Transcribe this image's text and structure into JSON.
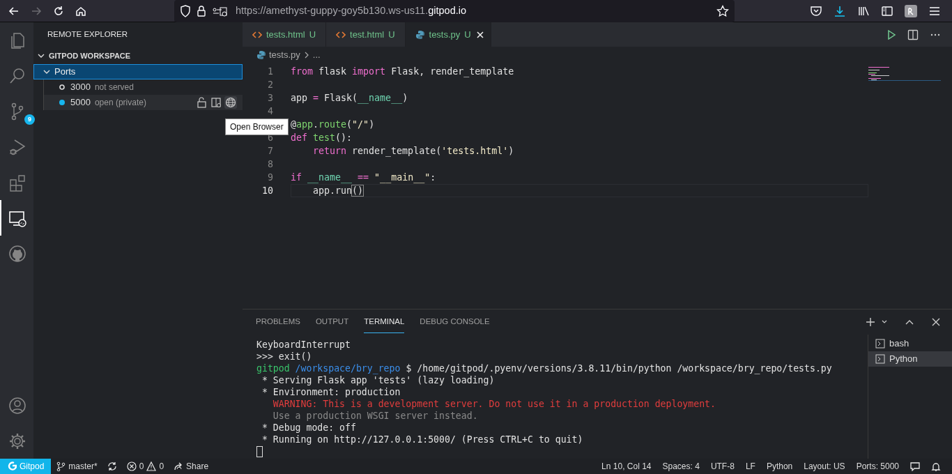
{
  "browser": {
    "nav": [
      {
        "kind": "back",
        "disabled": false
      },
      {
        "kind": "forward",
        "disabled": true
      },
      {
        "kind": "reload",
        "disabled": false
      },
      {
        "kind": "home",
        "disabled": false
      }
    ],
    "url_prefix": "https://amethyst-guppy-goy5b130.ws-us11.",
    "url_domain": "gitpod.io"
  },
  "activity_bar": {
    "items": [
      {
        "kind": "explorer",
        "selected": false
      },
      {
        "kind": "search",
        "selected": false
      },
      {
        "kind": "source-control",
        "selected": false,
        "badge": "9"
      },
      {
        "kind": "run-debug",
        "selected": false
      },
      {
        "kind": "extensions",
        "selected": false
      },
      {
        "kind": "remote",
        "selected": true
      },
      {
        "kind": "github",
        "selected": false
      }
    ],
    "bottom": [
      {
        "kind": "account"
      },
      {
        "kind": "settings"
      }
    ]
  },
  "sidebar": {
    "title": "REMOTE EXPLORER",
    "section": {
      "title": "GITPOD WORKSPACE",
      "expanded": true,
      "tree": {
        "label": "Ports",
        "expanded": true,
        "selected": true,
        "children": [
          {
            "port": "3000",
            "status": "not served",
            "served": false,
            "hovered": false
          },
          {
            "port": "5000",
            "status": "open (private)",
            "served": true,
            "hovered": true
          }
        ]
      }
    }
  },
  "tooltip": "Open Browser",
  "tabs": [
    {
      "kind": "html",
      "label": "tests.html",
      "badge": "U",
      "selected": false
    },
    {
      "kind": "html",
      "label": "test.html",
      "badge": "U",
      "selected": false
    },
    {
      "kind": "python",
      "label": "tests.py",
      "badge": "U",
      "selected": true
    }
  ],
  "breadcrumb": [
    "tests.py",
    "..."
  ],
  "code": [
    {
      "number": "1",
      "current": false,
      "tokens": [
        {
          "kind": "keyword",
          "text": "from"
        },
        {
          "kind": "plain",
          "text": " flask "
        },
        {
          "kind": "keyword",
          "text": "import"
        },
        {
          "kind": "plain",
          "text": " Flask, render_template"
        }
      ]
    },
    {
      "number": "2",
      "current": false
    },
    {
      "number": "3",
      "current": false,
      "tokens": [
        {
          "kind": "plain",
          "text": "app "
        },
        {
          "kind": "operator",
          "text": "="
        },
        {
          "kind": "plain",
          "text": " Flask("
        },
        {
          "kind": "variable",
          "text": "__name__"
        },
        {
          "kind": "plain",
          "text": ")"
        }
      ]
    },
    {
      "number": "4",
      "current": false
    },
    {
      "current": false,
      "tokens": [
        {
          "kind": "plain",
          "text": "@"
        },
        {
          "kind": "function",
          "text": "app"
        },
        {
          "kind": "plain",
          "text": "."
        },
        {
          "kind": "function",
          "text": "route"
        },
        {
          "kind": "plain",
          "text": "("
        },
        {
          "kind": "string",
          "text": "\"/\""
        },
        {
          "kind": "plain",
          "text": ")"
        }
      ]
    },
    {
      "number": "6",
      "current": false,
      "tokens": [
        {
          "kind": "keyword",
          "text": "def"
        },
        {
          "kind": "function",
          "text": " test"
        },
        {
          "kind": "plain",
          "text": "():"
        }
      ]
    },
    {
      "number": "7",
      "current": false,
      "tokens": [
        {
          "kind": "keyword",
          "text": "    return"
        },
        {
          "kind": "plain",
          "text": " render_template("
        },
        {
          "kind": "string",
          "text": "'tests.html'"
        },
        {
          "kind": "plain",
          "text": ")"
        }
      ]
    },
    {
      "number": "8",
      "current": false
    },
    {
      "number": "9",
      "current": false,
      "tokens": [
        {
          "kind": "keyword",
          "text": "if"
        },
        {
          "kind": "variable",
          "text": " __name__"
        },
        {
          "kind": "operator",
          "text": " =="
        },
        {
          "kind": "string",
          "text": " \"__main__\""
        },
        {
          "kind": "plain",
          "text": ":"
        }
      ]
    },
    {
      "number": "10",
      "current": true,
      "tokens": [
        {
          "kind": "plain",
          "text": "    app.run"
        },
        {
          "kind": "bracket",
          "text": "()"
        }
      ]
    }
  ],
  "panel": {
    "tabs": [
      {
        "label": "PROBLEMS",
        "selected": false
      },
      {
        "label": "OUTPUT",
        "selected": false
      },
      {
        "label": "TERMINAL",
        "selected": true
      },
      {
        "label": "DEBUG CONSOLE",
        "selected": false
      }
    ],
    "terminal": [
      {
        "tokens": [
          {
            "kind": "plain",
            "text": "KeyboardInterrupt"
          }
        ]
      },
      {
        "tokens": [
          {
            "kind": "plain",
            "text": ">>> exit()"
          }
        ]
      },
      {
        "tokens": [
          {
            "kind": "user",
            "text": "gitpod"
          },
          {
            "kind": "path",
            "text": " /workspace/bry_repo"
          },
          {
            "kind": "plain",
            "text": " $ /home/gitpod/.pyenv/versions/3.8.11/bin/python /workspace/bry_repo/tests.py"
          }
        ]
      },
      {
        "tokens": [
          {
            "kind": "plain",
            "text": " * Serving Flask app 'tests' (lazy loading)"
          }
        ]
      },
      {
        "tokens": [
          {
            "kind": "plain",
            "text": " * Environment: production"
          }
        ]
      },
      {
        "tokens": [
          {
            "kind": "warning",
            "text": "   WARNING: This is a development server. Do not use it in a production deployment."
          }
        ]
      },
      {
        "tokens": [
          {
            "kind": "dim",
            "text": "   Use a production WSGI server instead."
          }
        ]
      },
      {
        "tokens": [
          {
            "kind": "plain",
            "text": " * Debug mode: off"
          }
        ]
      },
      {
        "tokens": [
          {
            "kind": "plain",
            "text": " * Running on http://127.0.0.1:5000/ (Press CTRL+C to quit)"
          }
        ]
      }
    ],
    "terminals": [
      {
        "label": "bash",
        "selected": false
      },
      {
        "label": "Python",
        "selected": true
      }
    ]
  },
  "status_bar": {
    "left": [
      {
        "kind": "remote",
        "text": "Gitpod"
      },
      {
        "kind": "branch",
        "text": "master*"
      },
      {
        "kind": "sync"
      },
      {
        "kind": "problems",
        "errors": "0",
        "warnings": "0"
      },
      {
        "kind": "share",
        "text": "Share"
      }
    ],
    "right": [
      {
        "kind": "text",
        "text": "Ln 10, Col 14"
      },
      {
        "kind": "text",
        "text": "Spaces: 4"
      },
      {
        "kind": "text",
        "text": "UTF-8"
      },
      {
        "kind": "text",
        "text": "LF"
      },
      {
        "kind": "text",
        "text": "Python"
      },
      {
        "kind": "text",
        "text": "Layout: US"
      },
      {
        "kind": "text",
        "text": "Ports: 5000"
      },
      {
        "kind": "feedback"
      },
      {
        "kind": "bell"
      }
    ]
  }
}
